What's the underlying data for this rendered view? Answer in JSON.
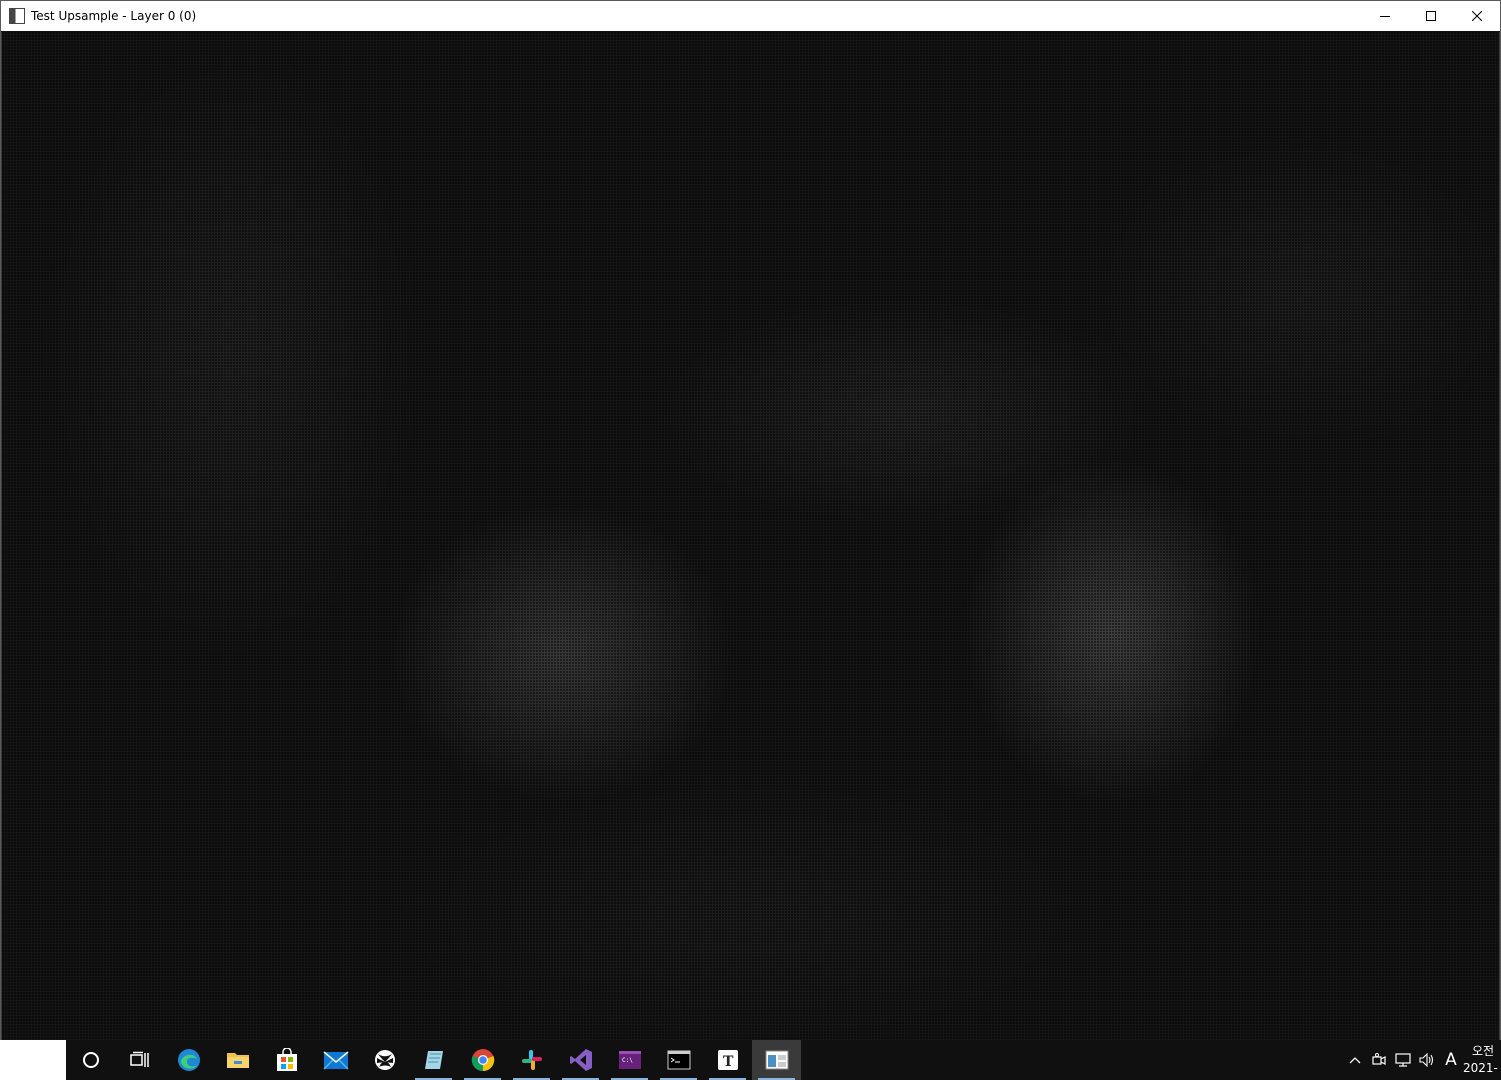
{
  "window": {
    "title": "Test Upsample - Layer 0 (0)",
    "minimize_glyph": "minimize-icon",
    "maximize_glyph": "maximize-icon",
    "close_glyph": "close-icon"
  },
  "canvas": {
    "description_icon": "upsampled-image-view"
  },
  "taskbar": {
    "apps": [
      {
        "name": "cortana",
        "icon": "cortana-icon",
        "running": false
      },
      {
        "name": "task-view",
        "icon": "task-view-icon",
        "running": false
      },
      {
        "name": "edge",
        "icon": "edge-icon",
        "running": false
      },
      {
        "name": "file-explorer",
        "icon": "folder-icon",
        "running": false
      },
      {
        "name": "store",
        "icon": "store-icon",
        "running": false
      },
      {
        "name": "mail",
        "icon": "mail-icon",
        "running": false
      },
      {
        "name": "xbox",
        "icon": "xbox-icon",
        "running": false
      },
      {
        "name": "notes",
        "icon": "notes-icon",
        "running": true
      },
      {
        "name": "chrome",
        "icon": "chrome-icon",
        "running": true
      },
      {
        "name": "slack",
        "icon": "slack-icon",
        "running": true
      },
      {
        "name": "visual-studio",
        "icon": "visual-studio-icon",
        "running": true
      },
      {
        "name": "vs-console",
        "icon": "vs-console-icon",
        "running": true
      },
      {
        "name": "terminal",
        "icon": "terminal-icon",
        "running": true
      },
      {
        "name": "typora",
        "icon": "typora-icon",
        "running": true
      },
      {
        "name": "test-upsample",
        "icon": "test-upsample-icon",
        "running": true,
        "active": true
      }
    ],
    "tray": {
      "ime_label": "A",
      "clock_time": "오전",
      "clock_date": "2021-"
    }
  },
  "colors": {
    "titlebar_bg": "#ffffff",
    "taskbar_bg": "#101010",
    "running_indicator": "#8ab4d9",
    "canvas_bg": "#141414"
  }
}
